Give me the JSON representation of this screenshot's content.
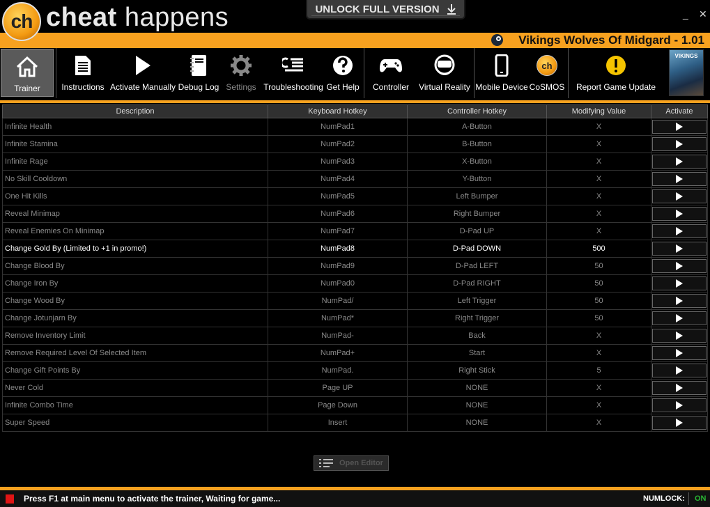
{
  "brand": {
    "logo_text": "ch",
    "name_bold": "cheat",
    "name_rest": " happens"
  },
  "unlock_button": "UNLOCK FULL VERSION",
  "window": {
    "minimize": "_",
    "close": "✕"
  },
  "game": {
    "title": "Vikings Wolves Of Midgard - 1.01"
  },
  "toolbar": {
    "trainer": "Trainer",
    "instructions": "Instructions",
    "activate_manually": "Activate Manually",
    "debug_log": "Debug Log",
    "settings": "Settings",
    "troubleshooting": "Troubleshooting",
    "get_help": "Get Help",
    "controller": "Controller",
    "virtual_reality": "Virtual Reality",
    "mobile_device": "Mobile Device",
    "cosmos": "CoSMOS",
    "report_update": "Report Game Update",
    "cosmos_icon_text": "ch",
    "box_art_text": "VIKINGS"
  },
  "table": {
    "headers": [
      "Description",
      "Keyboard Hotkey",
      "Controller Hotkey",
      "Modifying Value",
      "Activate"
    ],
    "rows": [
      {
        "desc": "Infinite Health",
        "key": "NumPad1",
        "ctrl": "A-Button",
        "val": "X"
      },
      {
        "desc": "Infinite Stamina",
        "key": "NumPad2",
        "ctrl": "B-Button",
        "val": "X"
      },
      {
        "desc": "Infinite Rage",
        "key": "NumPad3",
        "ctrl": "X-Button",
        "val": "X"
      },
      {
        "desc": "No Skill Cooldown",
        "key": "NumPad4",
        "ctrl": "Y-Button",
        "val": "X"
      },
      {
        "desc": "One Hit Kills",
        "key": "NumPad5",
        "ctrl": "Left Bumper",
        "val": "X"
      },
      {
        "desc": "Reveal Minimap",
        "key": "NumPad6",
        "ctrl": "Right Bumper",
        "val": "X"
      },
      {
        "desc": "Reveal Enemies On Minimap",
        "key": "NumPad7",
        "ctrl": "D-Pad UP",
        "val": "X"
      },
      {
        "desc": "Change Gold By (Limited to +1 in promo!)",
        "key": "NumPad8",
        "ctrl": "D-Pad DOWN",
        "val": "500"
      },
      {
        "desc": "Change Blood By",
        "key": "NumPad9",
        "ctrl": "D-Pad LEFT",
        "val": "50"
      },
      {
        "desc": "Change Iron By",
        "key": "NumPad0",
        "ctrl": "D-Pad RIGHT",
        "val": "50"
      },
      {
        "desc": "Change Wood By",
        "key": "NumPad/",
        "ctrl": "Left Trigger",
        "val": "50"
      },
      {
        "desc": "Change Jotunjarn By",
        "key": "NumPad*",
        "ctrl": "Right Trigger",
        "val": "50"
      },
      {
        "desc": "Remove Inventory Limit",
        "key": "NumPad-",
        "ctrl": "Back",
        "val": "X"
      },
      {
        "desc": "Remove Required Level Of Selected Item",
        "key": "NumPad+",
        "ctrl": "Start",
        "val": "X"
      },
      {
        "desc": "Change Gift Points By",
        "key": "NumPad.",
        "ctrl": "Right Stick",
        "val": "5"
      },
      {
        "desc": "Never Cold",
        "key": "Page UP",
        "ctrl": "NONE",
        "val": "X"
      },
      {
        "desc": "Infinite Combo Time",
        "key": "Page Down",
        "ctrl": "NONE",
        "val": "X"
      },
      {
        "desc": "Super Speed",
        "key": "Insert",
        "ctrl": "NONE",
        "val": "X"
      }
    ]
  },
  "open_editor": "Open Editor",
  "status": {
    "message": "Press F1 at main menu to activate the trainer, Waiting for game...",
    "numlock_label": "NUMLOCK:",
    "numlock_value": "ON"
  },
  "colors": {
    "accent": "#f7a11f",
    "status_led": "#e01515",
    "on_green": "#29b533"
  }
}
